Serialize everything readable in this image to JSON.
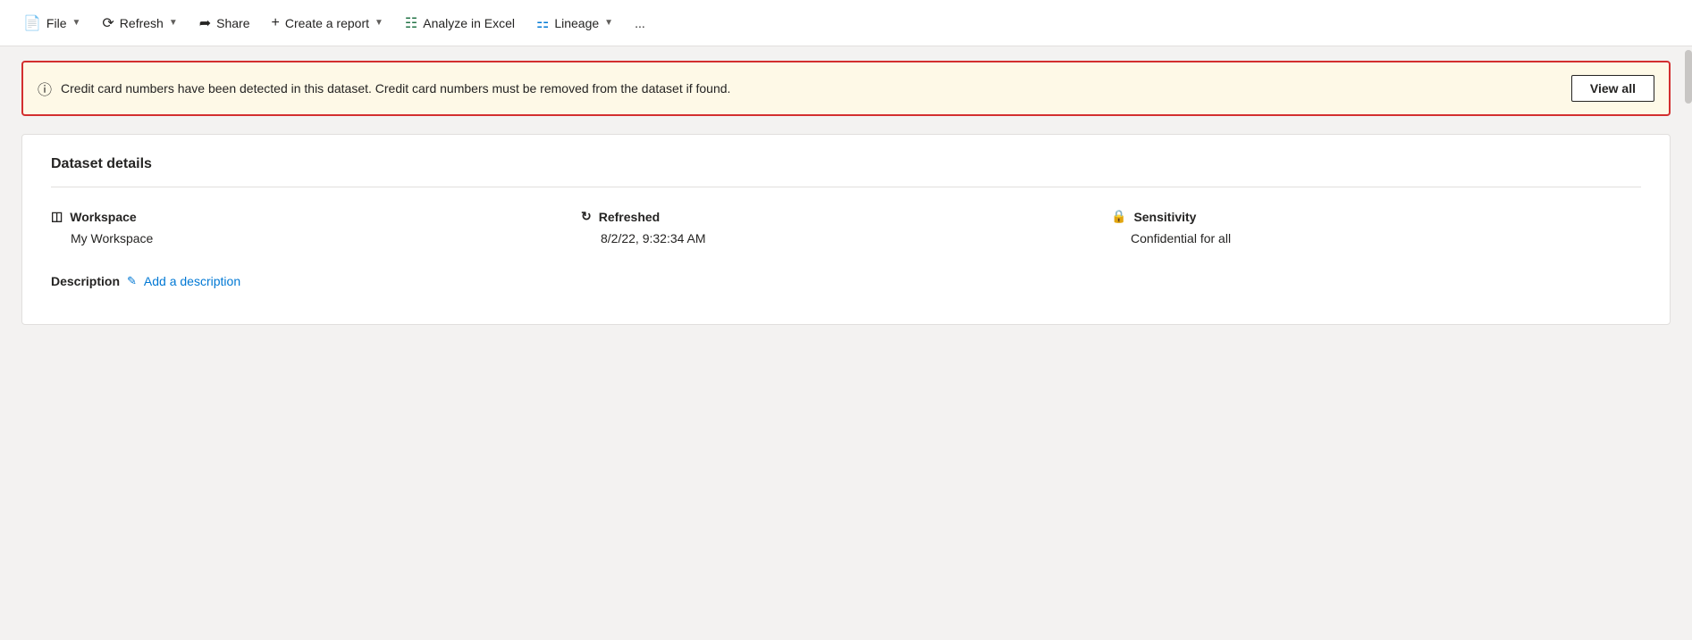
{
  "toolbar": {
    "file_label": "File",
    "refresh_label": "Refresh",
    "share_label": "Share",
    "create_report_label": "Create a report",
    "analyze_excel_label": "Analyze in Excel",
    "lineage_label": "Lineage",
    "more_label": "..."
  },
  "alert": {
    "text": "Credit card numbers have been detected in this dataset. Credit card numbers must be removed from the dataset if found.",
    "view_all_label": "View all"
  },
  "details": {
    "section_title": "Dataset details",
    "workspace_label": "Workspace",
    "workspace_value": "My Workspace",
    "refreshed_label": "Refreshed",
    "refreshed_value": "8/2/22, 9:32:34 AM",
    "sensitivity_label": "Sensitivity",
    "sensitivity_value": "Confidential for all",
    "description_label": "Description",
    "add_description_label": "Add a description"
  }
}
